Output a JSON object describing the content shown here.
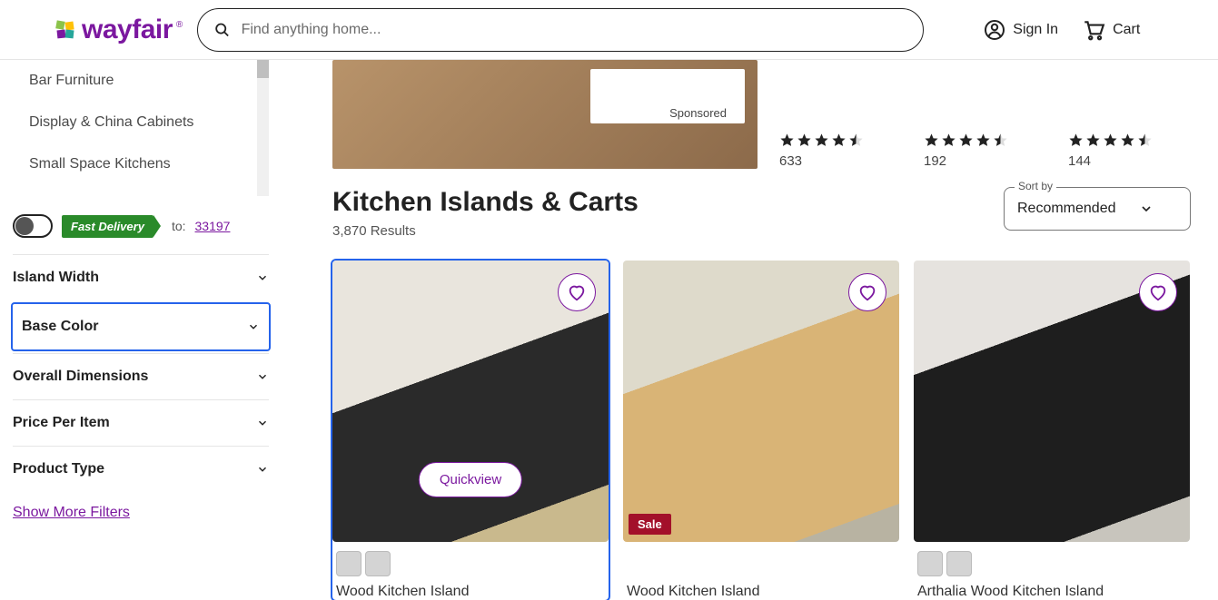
{
  "header": {
    "logo_text": "wayfair",
    "search_placeholder": "Find anything home...",
    "sign_in": "Sign In",
    "cart": "Cart"
  },
  "sidebar": {
    "categories": [
      "Bar Furniture",
      "Display & China Cabinets",
      "Small Space Kitchens"
    ],
    "fast_delivery_badge": "Fast Delivery",
    "fast_delivery_to": "to:",
    "zip": "33197",
    "filters": [
      {
        "label": "Island Width",
        "active": false
      },
      {
        "label": "Base Color",
        "active": true
      },
      {
        "label": "Overall Dimensions",
        "active": false
      },
      {
        "label": "Price Per Item",
        "active": false
      },
      {
        "label": "Product Type",
        "active": false
      }
    ],
    "show_more": "Show More Filters"
  },
  "reco": {
    "sponsored_label": "Sponsored",
    "items": [
      {
        "count": "633"
      },
      {
        "count": "192"
      },
      {
        "count": "144"
      }
    ]
  },
  "title": "Kitchen Islands & Carts",
  "results_count": "3,870 Results",
  "sort": {
    "label": "Sort by",
    "value": "Recommended"
  },
  "quickview": "Quickview",
  "sale_label": "Sale",
  "products": [
    {
      "title": "Wood Kitchen Island",
      "quickview": true,
      "sale": false,
      "swatches": 2,
      "active": true
    },
    {
      "title": "Wood Kitchen Island",
      "quickview": false,
      "sale": true,
      "swatches": 0,
      "active": false
    },
    {
      "title": "Arthalia Wood Kitchen Island",
      "quickview": false,
      "sale": false,
      "swatches": 2,
      "active": false
    }
  ]
}
